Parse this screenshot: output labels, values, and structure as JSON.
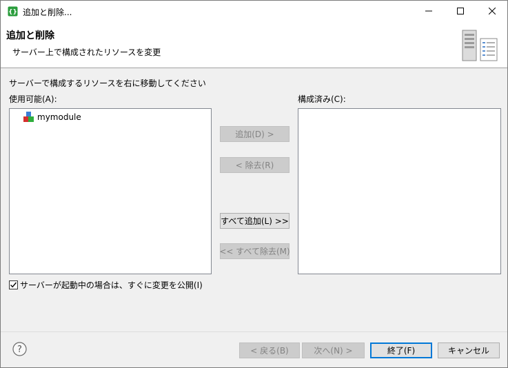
{
  "window": {
    "title": "追加と削除...",
    "icons": {
      "app": "eclipse-server-icon",
      "minimize": "minimize-icon",
      "maximize": "maximize-icon",
      "close": "close-icon"
    }
  },
  "banner": {
    "title": "追加と削除",
    "subtitle": "サーバー上で構成されたリソースを変更",
    "image": "server-wizard-icon"
  },
  "body": {
    "instruction": "サーバーで構成するリソースを右に移動してください",
    "available_label": "使用可能(A):",
    "configured_label": "構成済み(C):",
    "available_items": [
      {
        "label": "mymodule",
        "icon": "module-icon"
      }
    ],
    "configured_items": []
  },
  "buttons": {
    "add": "追加(D) >",
    "remove": "< 除去(R)",
    "add_all": "すべて追加(L) >>",
    "remove_all": "<< すべて除去(M)",
    "back": "< 戻る(B)",
    "next": "次へ(N) >",
    "finish": "終了(F)",
    "cancel": "キャンセル"
  },
  "options": {
    "publish_label": "サーバーが起動中の場合は、すぐに変更を公開(I)",
    "publish_checked": true
  },
  "footer": {
    "help_icon": "help-icon"
  }
}
